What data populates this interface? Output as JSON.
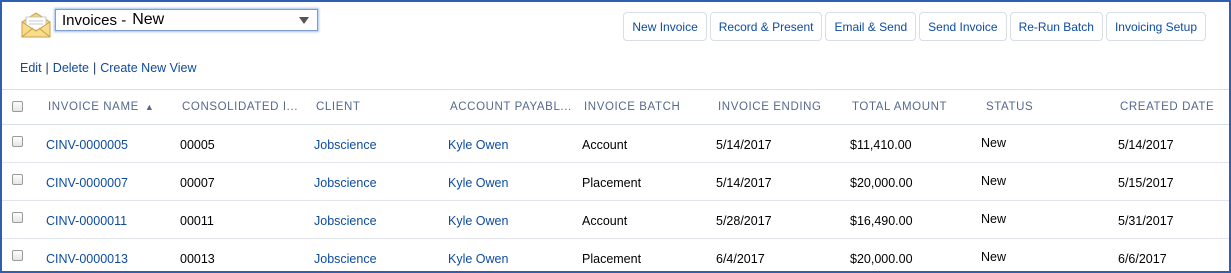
{
  "view": {
    "prefix": "Invoices -",
    "name": "New"
  },
  "toolbar": [
    {
      "label": "New Invoice"
    },
    {
      "label": "Record & Present"
    },
    {
      "label": "Email & Send"
    },
    {
      "label": "Send Invoice"
    },
    {
      "label": "Re-Run Batch"
    },
    {
      "label": "Invoicing Setup"
    }
  ],
  "view_links": {
    "edit": "Edit",
    "delete": "Delete",
    "create": "Create New View",
    "separator": "|"
  },
  "columns": [
    {
      "label": "Invoice Name",
      "sorted": "asc"
    },
    {
      "label": "Consolidated I..."
    },
    {
      "label": "Client"
    },
    {
      "label": "Account Payabl..."
    },
    {
      "label": "Invoice Batch"
    },
    {
      "label": "Invoice Ending"
    },
    {
      "label": "Total Amount"
    },
    {
      "label": "Status"
    },
    {
      "label": "Created Date"
    }
  ],
  "rows": [
    {
      "invoice_name": "CINV-0000005",
      "consolidated": "00005",
      "client": "Jobscience",
      "ap_contact": "Kyle Owen",
      "batch": "Account",
      "ending": "5/14/2017",
      "total": "$11,410.00",
      "status": "New",
      "created": "5/14/2017"
    },
    {
      "invoice_name": "CINV-0000007",
      "consolidated": "00007",
      "client": "Jobscience",
      "ap_contact": "Kyle Owen",
      "batch": "Placement",
      "ending": "5/14/2017",
      "total": "$20,000.00",
      "status": "New",
      "created": "5/15/2017"
    },
    {
      "invoice_name": "CINV-0000011",
      "consolidated": "00011",
      "client": "Jobscience",
      "ap_contact": "Kyle Owen",
      "batch": "Account",
      "ending": "5/28/2017",
      "total": "$16,490.00",
      "status": "New",
      "created": "5/31/2017"
    },
    {
      "invoice_name": "CINV-0000013",
      "consolidated": "00013",
      "client": "Jobscience",
      "ap_contact": "Kyle Owen",
      "batch": "Placement",
      "ending": "6/4/2017",
      "total": "$20,000.00",
      "status": "New",
      "created": "6/6/2017"
    }
  ],
  "icons": {
    "list_view": "mail-folder-icon",
    "sort": "sort-ascending-icon",
    "dropdown": "chevron-down-icon"
  },
  "colors": {
    "link": "#0d4b9e",
    "header_text": "#54698d",
    "frame_border": "#2f5fb3"
  }
}
